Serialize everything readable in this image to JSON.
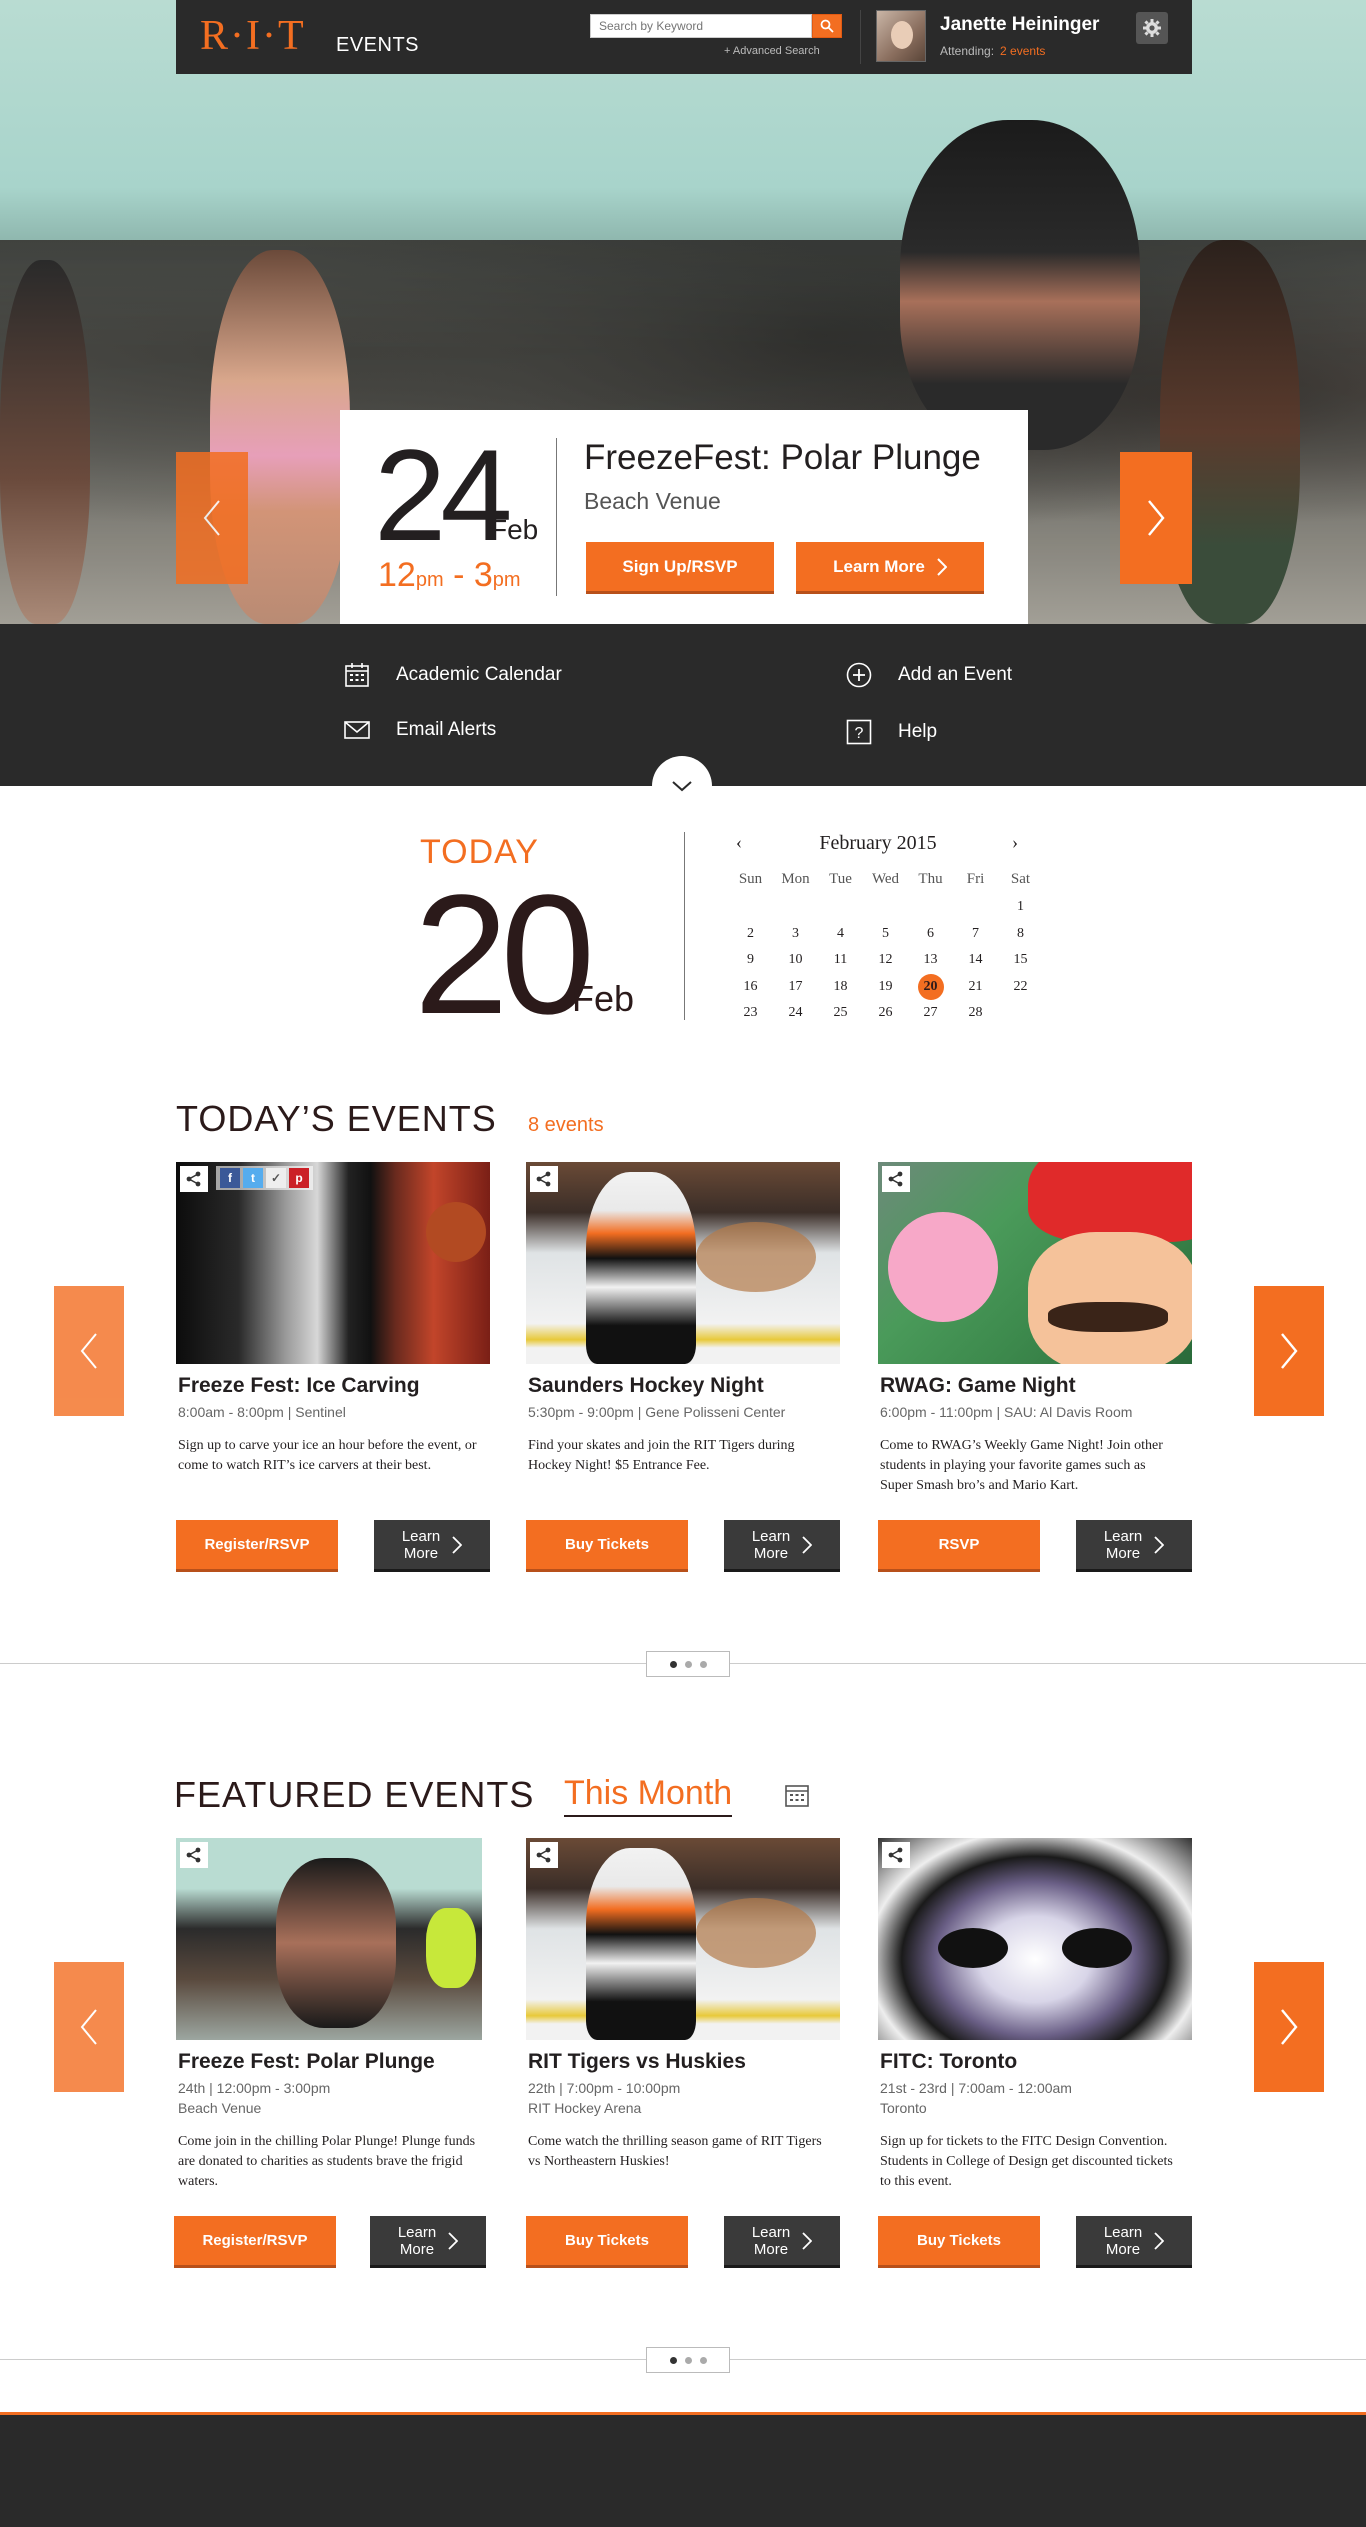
{
  "header": {
    "logo": "R·I·T",
    "logo_sub": "EVENTS",
    "search_placeholder": "Search by Keyword",
    "advanced_search": "+ Advanced Search",
    "user_name": "Janette Heininger",
    "attending_label": "Attending:",
    "attending_count": "2 events"
  },
  "hero": {
    "day": "24",
    "month": "Feb",
    "time_start": "12",
    "time_start_suffix": "pm",
    "time_sep": " - ",
    "time_end": "3",
    "time_end_suffix": "pm",
    "title": "FreezeFest: Polar Plunge",
    "venue": "Beach Venue",
    "primary_button": "Sign Up/RSVP",
    "secondary_button": "Learn More"
  },
  "quick_links": {
    "academic_calendar": "Academic Calendar",
    "add_event": "Add an Event",
    "email_alerts": "Email Alerts",
    "help": "Help"
  },
  "today": {
    "label": "TODAY",
    "day": "20",
    "month": "Feb"
  },
  "calendar": {
    "month_label": "February 2015",
    "prev": "‹",
    "next": "›",
    "weekdays": [
      "Sun",
      "Mon",
      "Tue",
      "Wed",
      "Thu",
      "Fri",
      "Sat"
    ],
    "days": [
      "",
      "",
      "",
      "",
      "",
      "",
      "1",
      "2",
      "3",
      "4",
      "5",
      "6",
      "7",
      "8",
      "9",
      "10",
      "11",
      "12",
      "13",
      "14",
      "15",
      "16",
      "17",
      "18",
      "19",
      "20",
      "21",
      "22",
      "23",
      "24",
      "25",
      "26",
      "27",
      "28",
      ""
    ],
    "selected": "20"
  },
  "todays_events": {
    "title": "TODAY’S EVENTS",
    "count": "8 events",
    "cards": [
      {
        "title": "Freeze Fest: Ice Carving",
        "time": "8:00am - 8:00pm",
        "sep": "|",
        "venue": "Sentinel",
        "desc": "Sign up to carve your ice an hour before the event, or come to watch RIT’s ice carvers at their best.",
        "primary": "Register/RSVP",
        "more_l1": "Learn",
        "more_l2": "More"
      },
      {
        "title": "Saunders Hockey Night",
        "time": "5:30pm - 9:00pm",
        "sep": "|",
        "venue": "Gene Polisseni Center",
        "desc": "Find your skates and join the RIT Tigers during Hockey Night!  $5 Entrance Fee.",
        "primary": "Buy Tickets",
        "more_l1": "Learn",
        "more_l2": "More"
      },
      {
        "title": "RWAG: Game Night",
        "time": "6:00pm - 11:00pm",
        "sep": "|",
        "venue": "SAU: Al Davis Room",
        "desc": "Come to RWAG’s Weekly Game Night! Join other students in playing your favorite games such as Super Smash bro’s and Mario Kart.",
        "primary": "RSVP",
        "more_l1": "Learn",
        "more_l2": "More"
      }
    ]
  },
  "featured_events": {
    "title": "FEATURED EVENTS",
    "filter": "This Month",
    "cards": [
      {
        "title": "Freeze Fest: Polar Plunge",
        "date": "24th | 12:00pm - 3:00pm",
        "venue": "Beach Venue",
        "desc": "Come join in the chilling Polar Plunge! Plunge funds are donated to charities as students brave the frigid waters.",
        "primary": "Register/RSVP",
        "more_l1": "Learn",
        "more_l2": "More"
      },
      {
        "title": "RIT Tigers vs Huskies",
        "date": "22th | 7:00pm - 10:00pm",
        "venue": "RIT Hockey Arena",
        "desc": "Come watch the thrilling season game of RIT Tigers vs Northeastern Huskies!",
        "primary": "Buy Tickets",
        "more_l1": "Learn",
        "more_l2": "More"
      },
      {
        "title": "FITC: Toronto",
        "date": "21st - 23rd | 7:00am - 12:00am",
        "venue": "Toronto",
        "desc": "Sign up for tickets to the FITC Design Convention. Students in College of Design get discounted tickets to this event.",
        "primary": "Buy Tickets",
        "more_l1": "Learn",
        "more_l2": "More"
      }
    ]
  },
  "colors": {
    "accent": "#f36e21",
    "dark": "#2a2a2a",
    "text": "#231f20"
  },
  "icons": [
    "search-icon",
    "gear-icon",
    "chevron-left-icon",
    "chevron-right-icon",
    "calendar-icon",
    "plus-circle-icon",
    "envelope-icon",
    "help-icon",
    "chevron-down-icon",
    "share-icon",
    "facebook-icon",
    "twitter-icon",
    "check-icon",
    "pinterest-icon"
  ]
}
